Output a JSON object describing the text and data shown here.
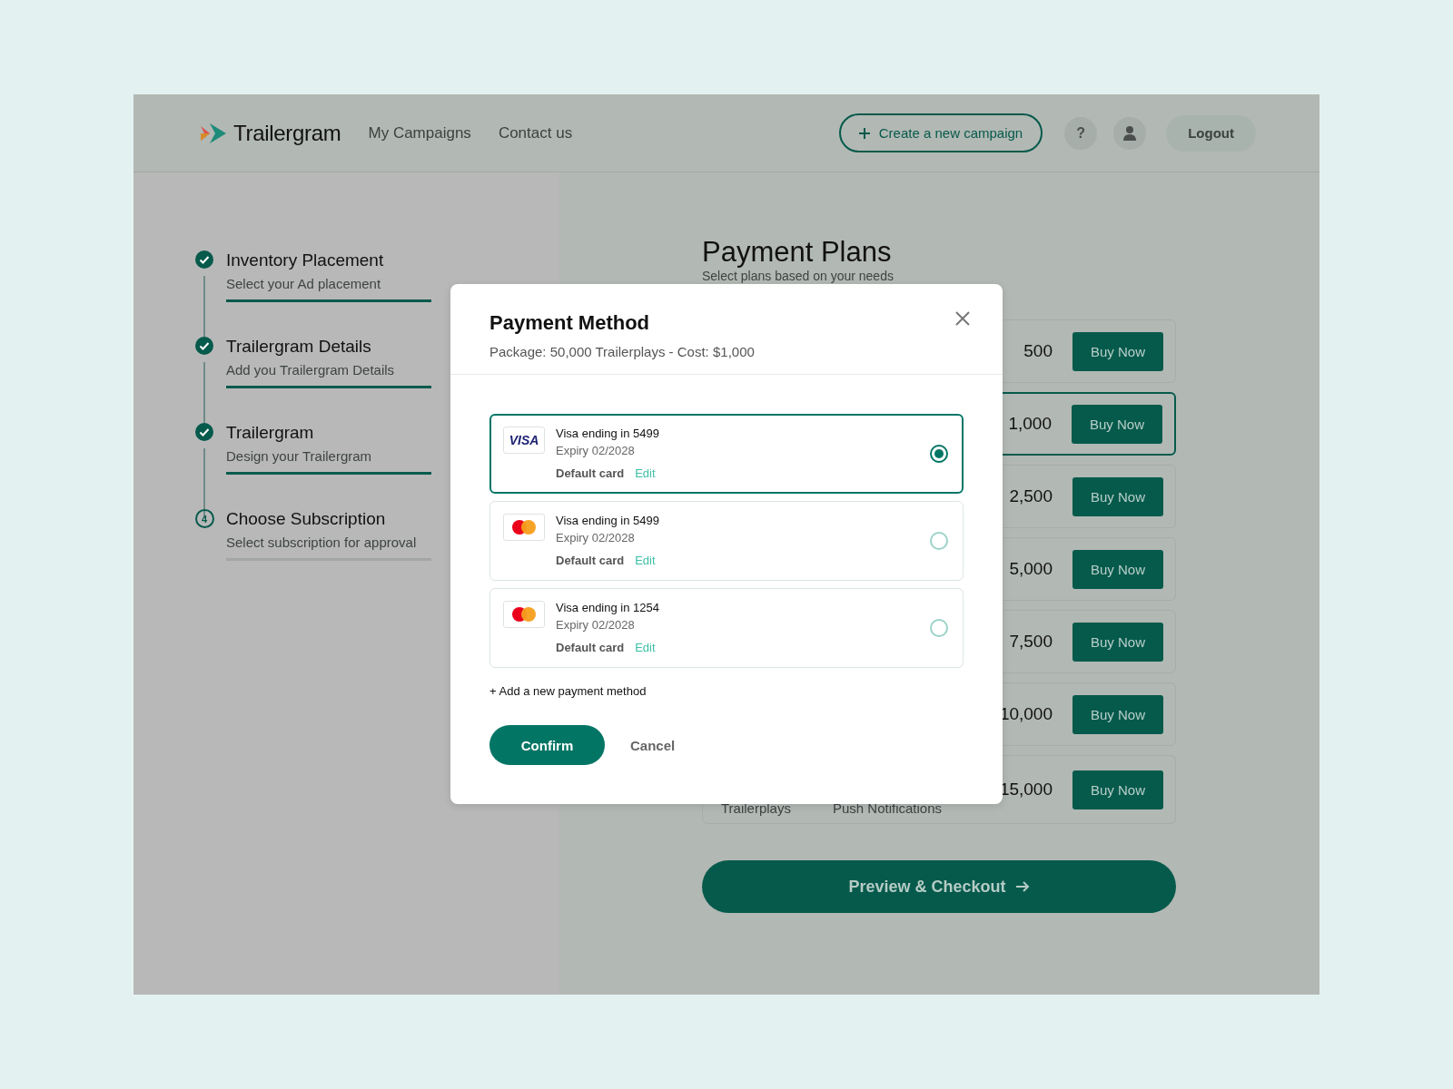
{
  "header": {
    "logo": "Trailergram",
    "nav": [
      {
        "label": "My Campaigns"
      },
      {
        "label": "Contact us"
      }
    ],
    "create_button": "Create a new campaign",
    "help_button": "?",
    "logout_button": "Logout"
  },
  "steps": [
    {
      "title": "Inventory Placement",
      "subtitle": "Select your Ad placement",
      "done": true
    },
    {
      "title": "Trailergram Details",
      "subtitle": "Add you Trailergram Details",
      "done": true
    },
    {
      "title": "Trailergram",
      "subtitle": "Design your Trailergram",
      "done": true
    },
    {
      "title": "Choose Subscription",
      "subtitle": "Select subscription for approval",
      "done": false,
      "number": "4"
    }
  ],
  "plans": {
    "title": "Payment Plans",
    "subtitle": "Select plans based on your needs",
    "items": [
      {
        "price": "500",
        "button": "Buy Now",
        "selected": false
      },
      {
        "price": "1,000",
        "button": "Buy Now",
        "selected": true
      },
      {
        "price": "2,500",
        "button": "Buy Now",
        "selected": false
      },
      {
        "price": "5,000",
        "button": "Buy Now",
        "selected": false
      },
      {
        "price": "7,500",
        "button": "Buy Now",
        "selected": false
      },
      {
        "price": "10,000",
        "button": "Buy Now",
        "selected": false
      },
      {
        "price": "15,000",
        "button": "Buy Now",
        "selected": false,
        "labels": [
          "Trailerplays",
          "Push Notifications"
        ]
      }
    ],
    "checkout_button": "Preview & Checkout"
  },
  "modal": {
    "title": "Payment Method",
    "subtitle": "Package: 50,000 Trailerplays - Cost: $1,000",
    "methods": [
      {
        "kind": "visa",
        "logo_text": "VISA",
        "name": "Visa ending in 5499",
        "expiry": "Expiry 02/2028",
        "default_label": "Default card",
        "edit_label": "Edit",
        "selected": true
      },
      {
        "kind": "mastercard",
        "name": "Visa ending in 5499",
        "expiry": "Expiry 02/2028",
        "default_label": "Default card",
        "edit_label": "Edit",
        "selected": false
      },
      {
        "kind": "mastercard",
        "name": "Visa ending in 1254",
        "expiry": "Expiry 02/2028",
        "default_label": "Default card",
        "edit_label": "Edit",
        "selected": false
      }
    ],
    "add_link": "+ Add a new payment method",
    "confirm_button": "Confirm",
    "cancel_button": "Cancel"
  }
}
